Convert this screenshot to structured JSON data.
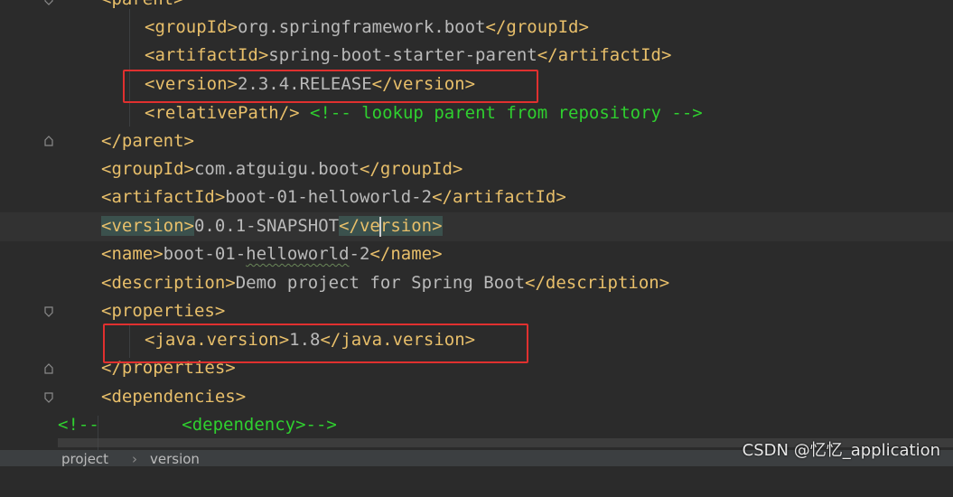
{
  "editor": {
    "lines": {
      "l0": {
        "open": "<parent>"
      },
      "l1": {
        "open": "<groupId>",
        "value": "org.springframework.boot",
        "close": "</groupId>"
      },
      "l2": {
        "open": "<artifactId>",
        "value": "spring-boot-starter-parent",
        "close": "</artifactId>"
      },
      "l3": {
        "open": "<version>",
        "value": "2.3.4.RELEASE",
        "close": "</version>"
      },
      "l4": {
        "open": "<relativePath/>",
        "comment": "<!-- lookup parent from repository -->"
      },
      "l5": {
        "close": "</parent>"
      },
      "l6": {
        "open": "<groupId>",
        "value": "com.atguigu.boot",
        "close": "</groupId>"
      },
      "l7": {
        "open": "<artifactId>",
        "value": "boot-01-helloworld-2",
        "close": "</artifactId>"
      },
      "l8": {
        "open": "<version>",
        "value": "0.0.1-SNAPSHOT",
        "close_a": "</ve",
        "close_b": "rsion>"
      },
      "l9": {
        "open_a": "<name>",
        "value_a": "boot-01-",
        "value_b": "helloworld",
        "value_c": "-2",
        "close": "</name>"
      },
      "l10": {
        "open": "<description>",
        "value": "Demo project for Spring Boot",
        "close": "</description>"
      },
      "l11": {
        "open": "<properties>"
      },
      "l12": {
        "open": "<java.version>",
        "value": "1.8",
        "close": "</java.version>"
      },
      "l13": {
        "close": "</properties>"
      },
      "l14": {
        "open": "<dependencies>"
      },
      "l15": {
        "comment_a": "<!--",
        "comment_b": "<dependency>-->"
      }
    }
  },
  "breadcrumb": {
    "items": [
      "project",
      "version"
    ],
    "separator": "›"
  },
  "watermark": "CSDN @忆忆_application",
  "colors": {
    "background": "#2b2b2b",
    "tag": "#e8bf6a",
    "text": "#bababa",
    "comment": "#2fd02f",
    "highlight_box": "#e0302f"
  },
  "icons": [
    "fold-start-icon",
    "fold-end-icon"
  ]
}
